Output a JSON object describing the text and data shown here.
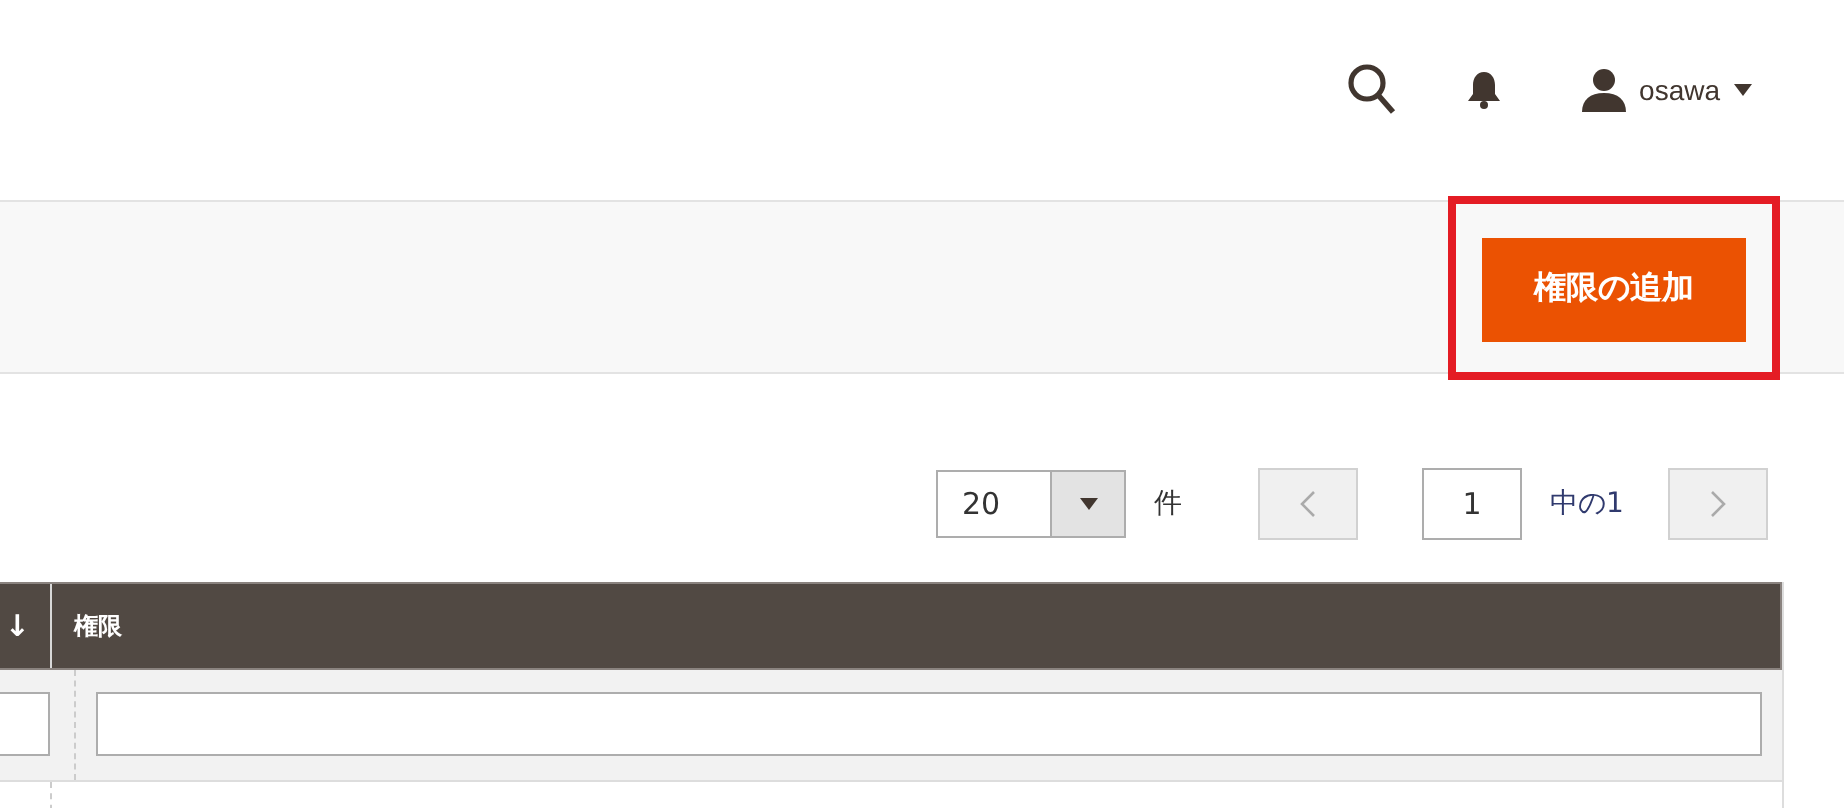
{
  "header": {
    "user": "osawa"
  },
  "action": {
    "button": "権限の追加",
    "highlighted": true
  },
  "pager": {
    "page_size": "20",
    "unit": "件",
    "page": "1",
    "of_total": "中の1"
  },
  "table": {
    "columns": [
      {
        "label": "↓"
      },
      {
        "label": "権限"
      }
    ]
  }
}
